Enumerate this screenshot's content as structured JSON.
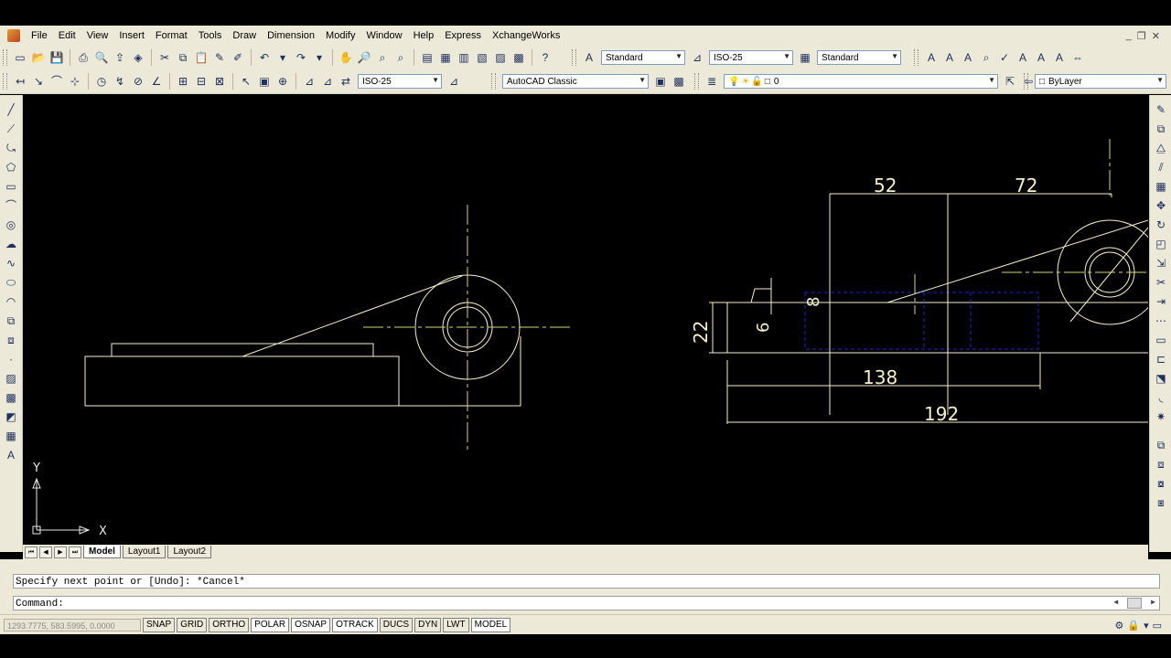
{
  "menu": [
    "File",
    "Edit",
    "View",
    "Insert",
    "Format",
    "Tools",
    "Draw",
    "Dimension",
    "Modify",
    "Window",
    "Help",
    "Express",
    "XchangeWorks"
  ],
  "toolbar1": {
    "text_style": "Standard",
    "dim_style": "ISO-25",
    "table_style": "Standard"
  },
  "toolbar2": {
    "dim_style": "ISO-25",
    "workspace": "AutoCAD Classic",
    "layer": "0",
    "color": "ByLayer"
  },
  "drawing": {
    "dim_52": "52",
    "dim_72": "72",
    "dim_22": "22",
    "dim_6": "6",
    "dim_8": "8",
    "dim_138": "138",
    "dim_192": "192",
    "ucs_x": "X",
    "ucs_y": "Y"
  },
  "layout_tabs": [
    "Model",
    "Layout1",
    "Layout2"
  ],
  "command": {
    "history": "Specify next point or [Undo]: *Cancel*",
    "prompt": "Command:"
  },
  "status": {
    "coords": "1293.7775, 583.5995, 0.0000",
    "buttons": [
      "SNAP",
      "GRID",
      "ORTHO",
      "POLAR",
      "OSNAP",
      "OTRACK",
      "DUCS",
      "DYN",
      "LWT",
      "MODEL"
    ]
  },
  "colors": {
    "geometry": "#f5f0c8",
    "centerline": "#d8d86a",
    "hidden": "#2222cc",
    "canvas": "#000000",
    "chrome": "#ece9d8"
  }
}
